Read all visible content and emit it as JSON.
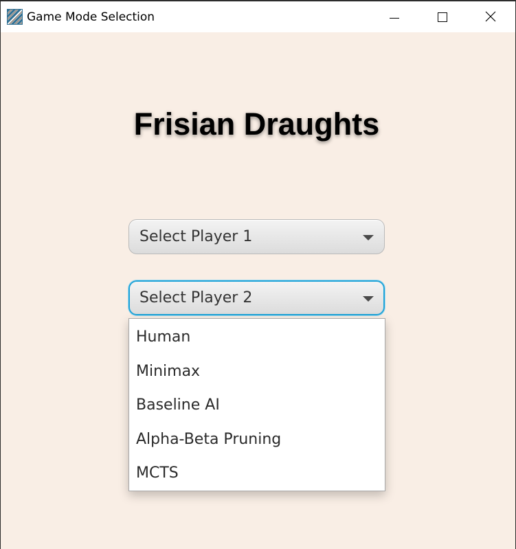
{
  "window": {
    "title": "Game Mode Selection",
    "icon": "app-checker-icon",
    "controls": [
      "minimize-icon",
      "maximize-icon",
      "close-icon"
    ]
  },
  "main": {
    "heading": "Frisian Draughts",
    "player1_select": {
      "value": "Select Player 1",
      "icon": "chevron-down-icon"
    },
    "player2_select": {
      "value": "Select Player 2",
      "icon": "chevron-down-icon",
      "focus_color": "#1fa3d8",
      "options": [
        "Human",
        "Minimax",
        "Baseline AI",
        "Alpha-Beta Pruning",
        "MCTS"
      ]
    }
  },
  "colors": {
    "background": "#f9eee5",
    "titlebar": "#ffffff",
    "accent": "#1fa3d8"
  }
}
